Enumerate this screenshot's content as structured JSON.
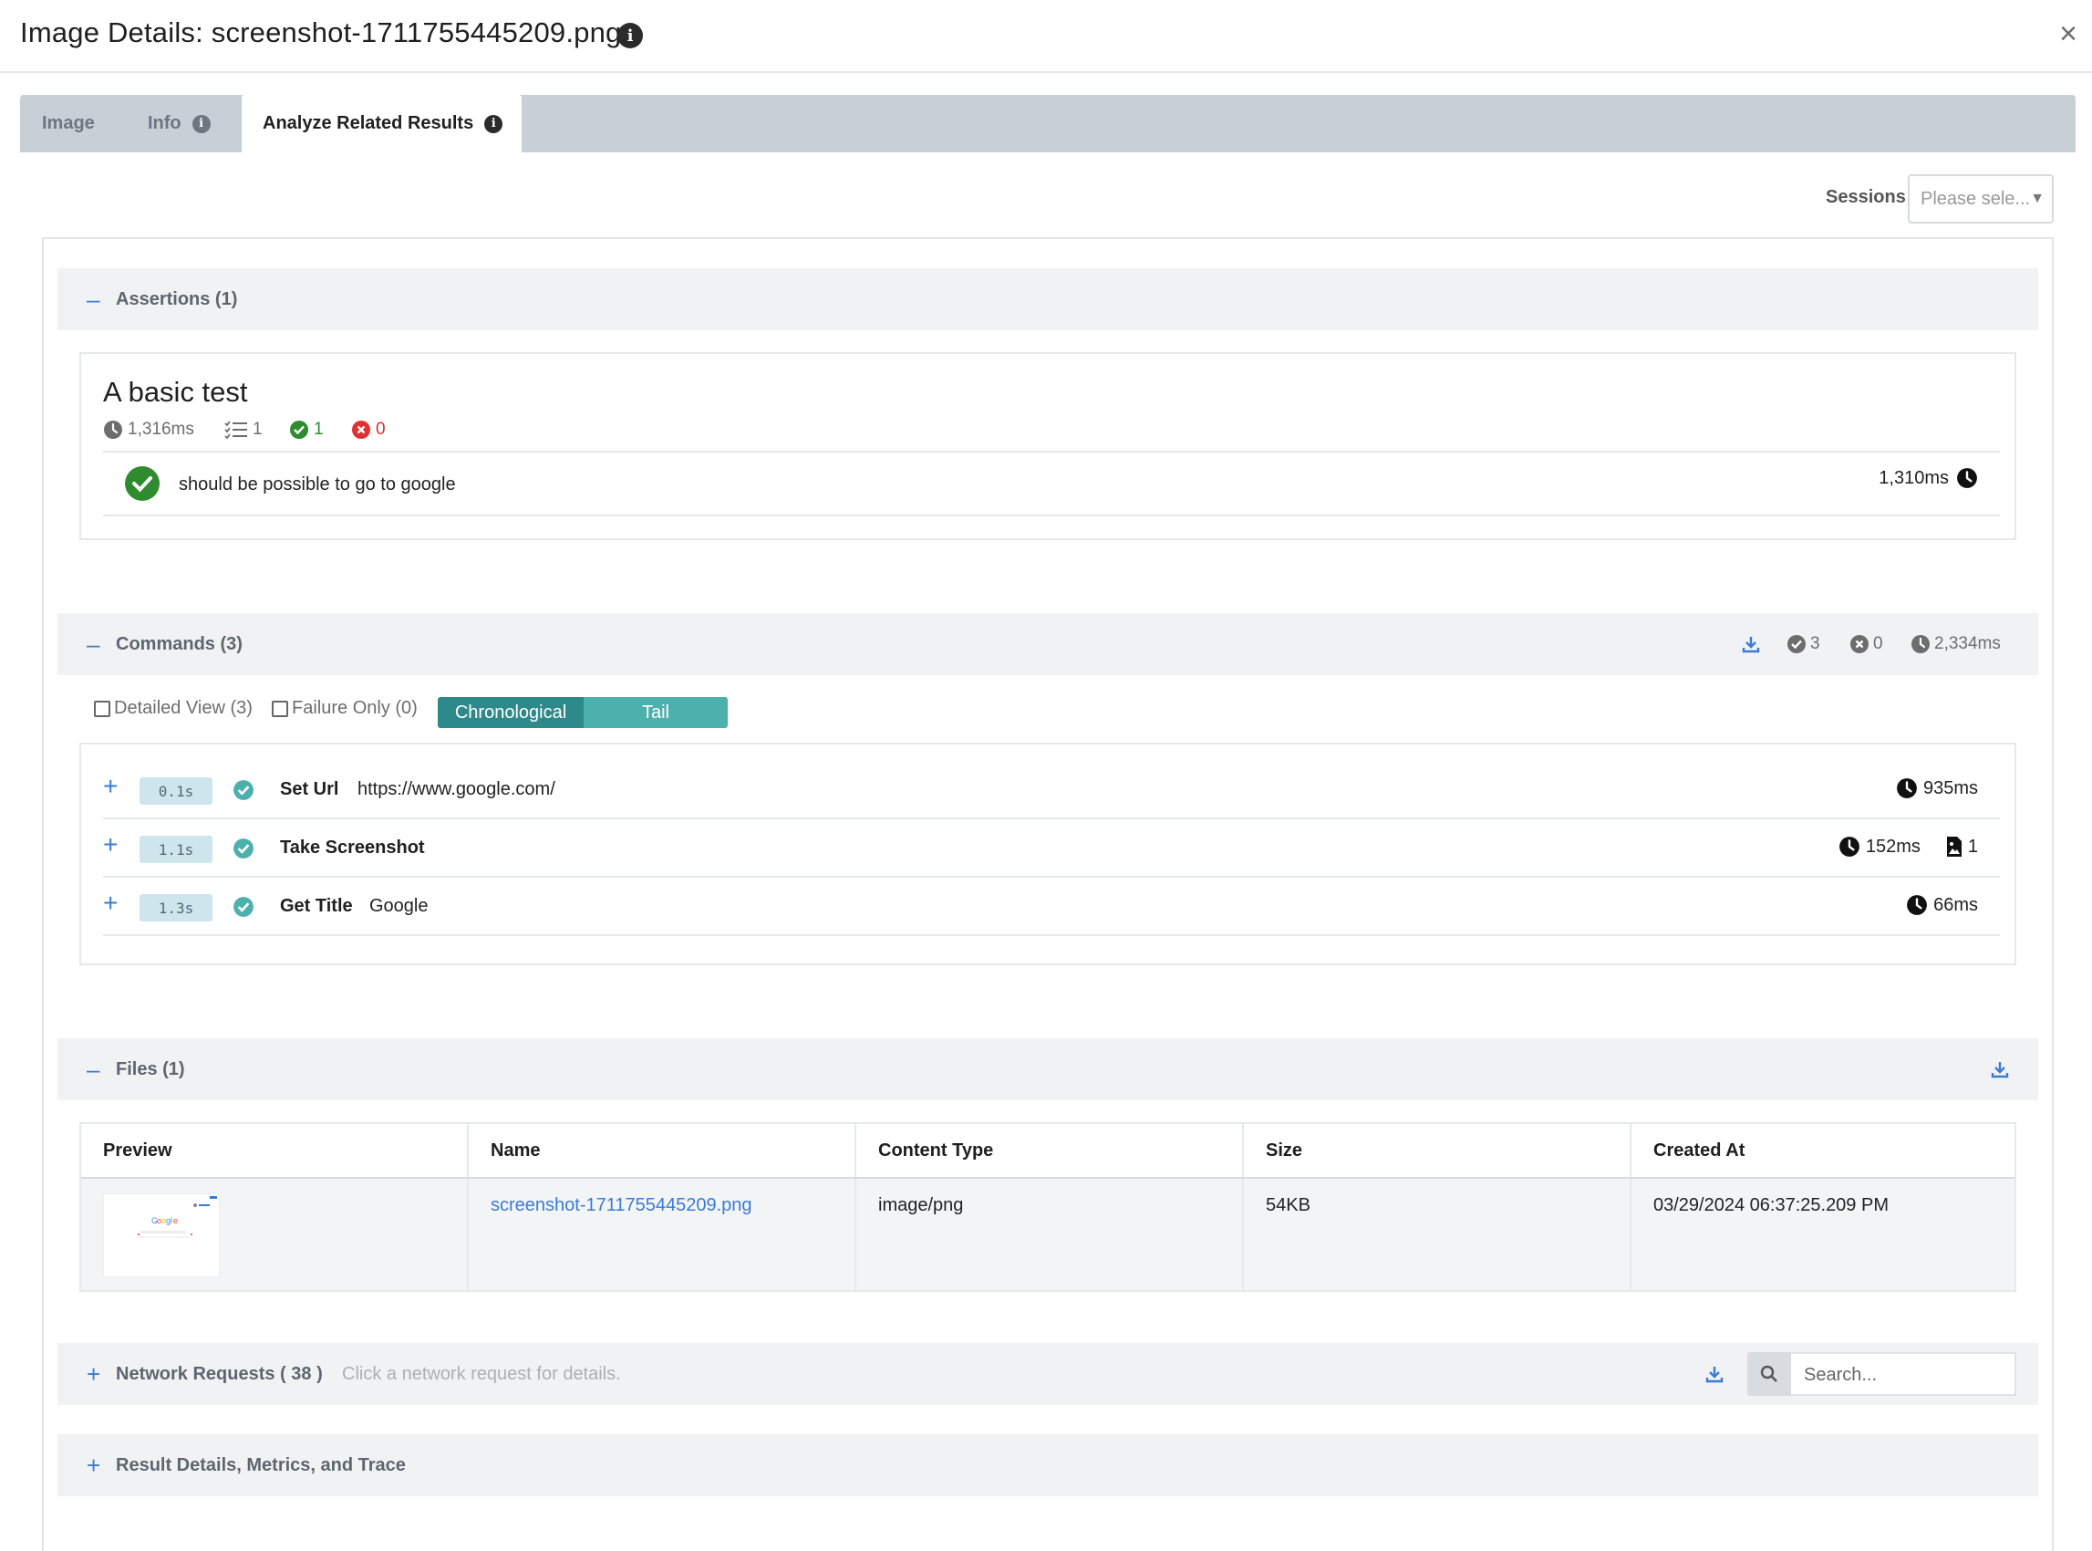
{
  "header": {
    "title": "Image Details: screenshot-1711755445209.png",
    "info_icon": "i",
    "close_icon": "×"
  },
  "tabs": [
    {
      "label": "Image",
      "active": false
    },
    {
      "label": "Info",
      "active": false,
      "has_info": true
    },
    {
      "label": "Analyze Related Results",
      "active": true,
      "has_info": true
    }
  ],
  "sessions": {
    "label": "Sessions",
    "placeholder": "Please sele..."
  },
  "assertions": {
    "toggle": "–",
    "title": "Assertions (1)",
    "test": {
      "name": "A basic test",
      "duration": "1,316ms",
      "count": "1",
      "passed": "1",
      "failed": "0"
    },
    "items": [
      {
        "text": "should be possible to go to google",
        "duration": "1,310ms"
      }
    ]
  },
  "commands": {
    "toggle": "–",
    "title": "Commands (3)",
    "stats": {
      "passed": "3",
      "failed": "0",
      "duration": "2,334ms"
    },
    "options": {
      "detailed_view": "Detailed View (3)",
      "failure_only": "Failure Only (0)",
      "order_chronological": "Chronological",
      "order_tail": "Tail"
    },
    "rows": [
      {
        "time": "0.1s",
        "name": "Set Url",
        "value": "https://www.google.com/",
        "duration": "935ms"
      },
      {
        "time": "1.1s",
        "name": "Take Screenshot",
        "value": "",
        "duration": "152ms",
        "files": "1"
      },
      {
        "time": "1.3s",
        "name": "Get Title",
        "value": "Google",
        "duration": "66ms"
      }
    ]
  },
  "files": {
    "toggle": "–",
    "title": "Files (1)",
    "columns": [
      "Preview",
      "Name",
      "Content Type",
      "Size",
      "Created At"
    ],
    "rows": [
      {
        "name": "screenshot-1711755445209.png",
        "content_type": "image/png",
        "size": "54KB",
        "created_at": "03/29/2024 06:37:25.209 PM"
      }
    ]
  },
  "network": {
    "toggle": "+",
    "title": "Network Requests ( 38 )",
    "hint": "Click a network request for details.",
    "search_placeholder": "Search..."
  },
  "result_details": {
    "toggle": "+",
    "title": "Result Details, Metrics, and Trace"
  },
  "colors": {
    "accent_blue": "#3a7bd5",
    "pass_green": "#2e8b2e",
    "fail_red": "#e03030",
    "teal_dark": "#2e8a8a",
    "teal_light": "#4cb0ad"
  }
}
